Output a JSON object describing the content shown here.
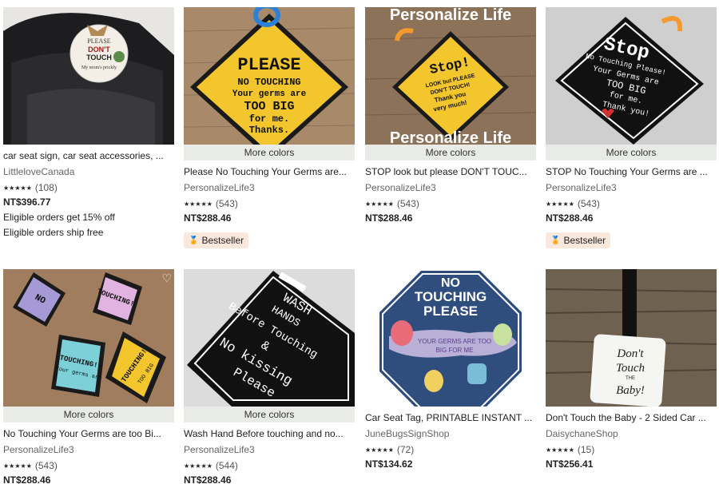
{
  "listings": [
    {
      "title": "car seat sign, car seat accessories, ...",
      "shop": "LittleloveCanada",
      "stars": "★★★★★",
      "reviews": "(108)",
      "price": "NT$396.77",
      "line1": "Eligible orders get 15% off",
      "line2": "Eligible orders ship free",
      "image_text": [
        "PLEASE",
        "DON'T",
        "TOUCH",
        "My mom's prickly"
      ]
    },
    {
      "more_colors": "More colors",
      "title": "Please No Touching Your Germs are...",
      "shop": "PersonalizeLife3",
      "stars": "★★★★★",
      "reviews": "(543)",
      "price": "NT$288.46",
      "badge": "Bestseller",
      "image_text": [
        "PLEASE",
        "NO TOUCHING",
        "Your germs are",
        "TOO BIG",
        "for me.",
        "Thanks."
      ]
    },
    {
      "more_colors": "More colors",
      "title": "STOP look but please DON'T TOUC...",
      "shop": "PersonalizeLife3",
      "stars": "★★★★★",
      "reviews": "(543)",
      "price": "NT$288.46",
      "image_text": [
        "Personalize Life",
        "Stop!",
        "LOOK but PLEASE",
        "DON'T TOUCH!",
        "Thank you",
        "very much!",
        "Personalize Life"
      ]
    },
    {
      "more_colors": "More colors",
      "title": "STOP No Touching Your Germs are ...",
      "shop": "PersonalizeLife3",
      "stars": "★★★★★",
      "reviews": "(543)",
      "price": "NT$288.46",
      "badge": "Bestseller",
      "image_text": [
        "Stop",
        "No Touching Please!",
        "Your Germs are",
        "TOO BIG",
        "for me.",
        "Thank you!"
      ]
    },
    {
      "more_colors": "More colors",
      "title": "No Touching Your Germs are too Bi...",
      "shop": "PersonalizeLife3",
      "stars": "★★★★★",
      "reviews": "(543)",
      "price": "NT$288.46",
      "image_text": [
        "NO",
        "TOUCHING!",
        "Your germs are",
        "TOO BIG",
        "for me!",
        "Thanks."
      ]
    },
    {
      "more_colors": "More colors",
      "title": "Wash Hand Before touching and no...",
      "shop": "PersonalizeLife3",
      "stars": "★★★★★",
      "reviews": "(544)",
      "price": "NT$288.46",
      "image_text": [
        "WASH",
        "HANDS",
        "Before Touching",
        "&",
        "No kissing",
        "Please"
      ]
    },
    {
      "title": "Car Seat Tag, PRINTABLE INSTANT ...",
      "shop": "JuneBugsSignShop",
      "stars": "★★★★★",
      "reviews": "(72)",
      "price": "NT$134.62",
      "image_text": [
        "NO",
        "TOUCHING",
        "PLEASE",
        "YOUR GERMS ARE TOO",
        "BIG FOR ME"
      ]
    },
    {
      "title": "Don't Touch the Baby - 2 Sided Car ...",
      "shop": "DaisychaneShop",
      "stars": "★★★★★",
      "reviews": "(15)",
      "price": "NT$256.41",
      "image_text": [
        "Don't",
        "Touch",
        "THE",
        "Baby!"
      ]
    }
  ],
  "icons": {
    "favorite": "heart-icon",
    "bestseller": "award-icon"
  }
}
